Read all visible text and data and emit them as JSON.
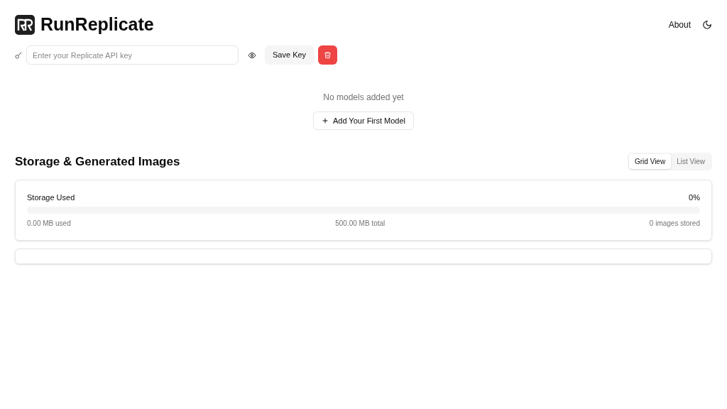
{
  "header": {
    "title": "RunReplicate",
    "nav": [
      "About"
    ]
  },
  "api_key": {
    "placeholder": "Enter your Replicate API key",
    "save_label": "Save Key"
  },
  "models": {
    "empty_text": "No models added yet",
    "add_label": "Add Your First Model"
  },
  "storage": {
    "title": "Storage & Generated Images",
    "views": [
      {
        "label": "Grid View",
        "selected": true
      },
      {
        "label": "List View",
        "selected": false
      }
    ],
    "label": "Storage Used",
    "percent": "0%",
    "level": 0,
    "used": "0.00 MB used",
    "total": "500.00 MB total",
    "count": "0 images stored"
  }
}
